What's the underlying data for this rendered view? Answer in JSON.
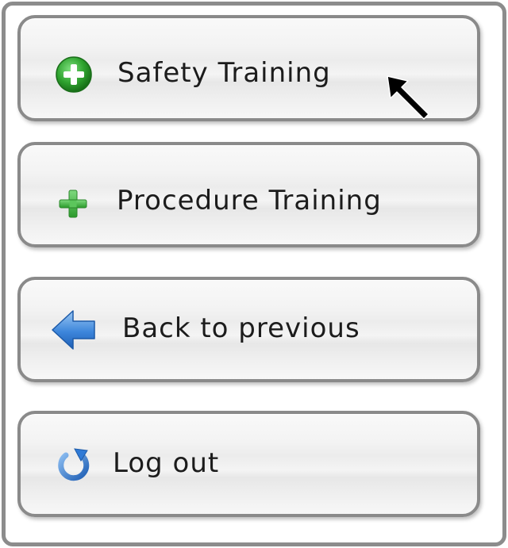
{
  "menu": {
    "items": [
      {
        "label": "Safety Training",
        "icon": "green-plus-circle-icon"
      },
      {
        "label": "Procedure Training",
        "icon": "green-plus-icon"
      },
      {
        "label": "Back to previous",
        "icon": "blue-left-arrow-icon"
      },
      {
        "label": "Log out",
        "icon": "blue-refresh-icon"
      }
    ]
  },
  "colors": {
    "border": "#8a8a8a",
    "green": "#2fa32f",
    "blue": "#2f7ad6",
    "text": "#1c1c1c"
  },
  "cursor": {
    "icon": "arrow-cursor-icon"
  }
}
